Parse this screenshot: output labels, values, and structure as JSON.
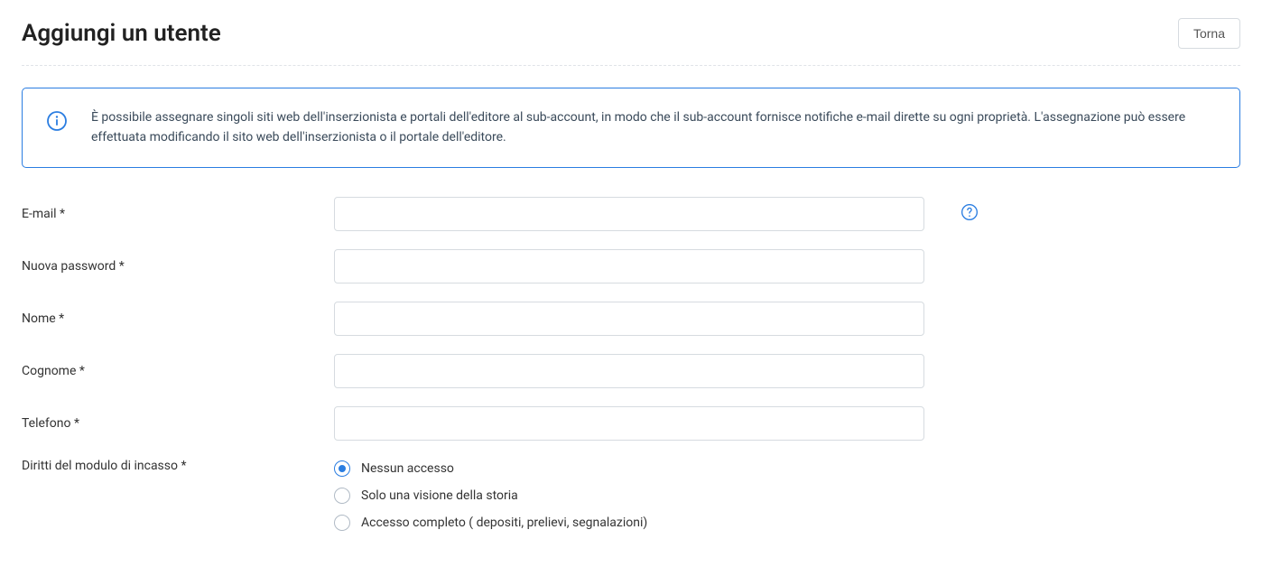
{
  "header": {
    "title": "Aggiungi un utente",
    "back_label": "Torna"
  },
  "info": {
    "text": "È possibile assegnare singoli siti web dell'inserzionista e portali dell'editore al sub-account, in modo che il sub-account fornisce notifiche e-mail dirette su ogni proprietà. L'assegnazione può essere effettuata modificando il sito web dell'inserzionista o il portale dell'editore."
  },
  "form": {
    "email": {
      "label": "E-mail *",
      "value": ""
    },
    "password": {
      "label": "Nuova password *",
      "value": ""
    },
    "firstname": {
      "label": "Nome *",
      "value": ""
    },
    "lastname": {
      "label": "Cognome *",
      "value": ""
    },
    "phone": {
      "label": "Telefono *",
      "value": ""
    },
    "rights": {
      "label": "Diritti del modulo di incasso *",
      "options": [
        {
          "label": "Nessun accesso",
          "checked": true
        },
        {
          "label": "Solo una visione della storia",
          "checked": false
        },
        {
          "label": "Accesso completo ( depositi, prelievi, segnalazioni)",
          "checked": false
        }
      ]
    }
  },
  "colors": {
    "accent": "#2a7de1",
    "border": "#d6dbe0"
  }
}
